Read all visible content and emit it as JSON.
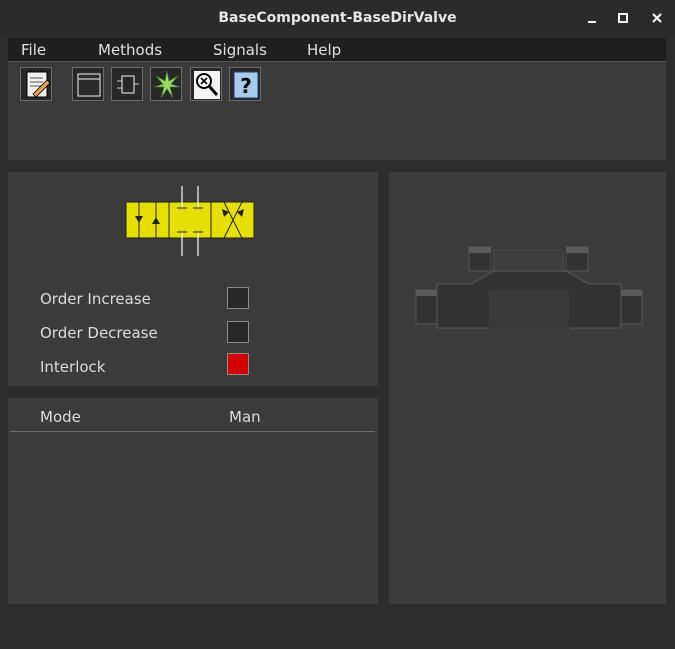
{
  "window": {
    "title": "BaseComponent-BaseDirValve"
  },
  "menu": [
    "File",
    "Methods",
    "Signals",
    "Help"
  ],
  "toolbar": {
    "buttons": [
      {
        "name": "trend-button",
        "icon": "notepad-pencil-icon"
      },
      {
        "name": "graph-button",
        "icon": "window-icon"
      },
      {
        "name": "object-button",
        "icon": "component-icon"
      },
      {
        "name": "crossref-button",
        "icon": "starburst-icon"
      },
      {
        "name": "open-object-button",
        "icon": "magnifier-x-icon"
      },
      {
        "name": "help-button",
        "icon": "question-icon"
      }
    ]
  },
  "signals": [
    {
      "label": "Order Increase",
      "state": "off",
      "color": "#282828"
    },
    {
      "label": "Order Decrease",
      "state": "off",
      "color": "#282828"
    },
    {
      "label": "Interlock",
      "state": "on",
      "color": "#d40000"
    }
  ],
  "mode": {
    "label": "Mode",
    "value": "Man"
  },
  "colors": {
    "valve_symbol": "#e6e000",
    "led_on": "#d40000",
    "panel": "#3b3b3b"
  }
}
